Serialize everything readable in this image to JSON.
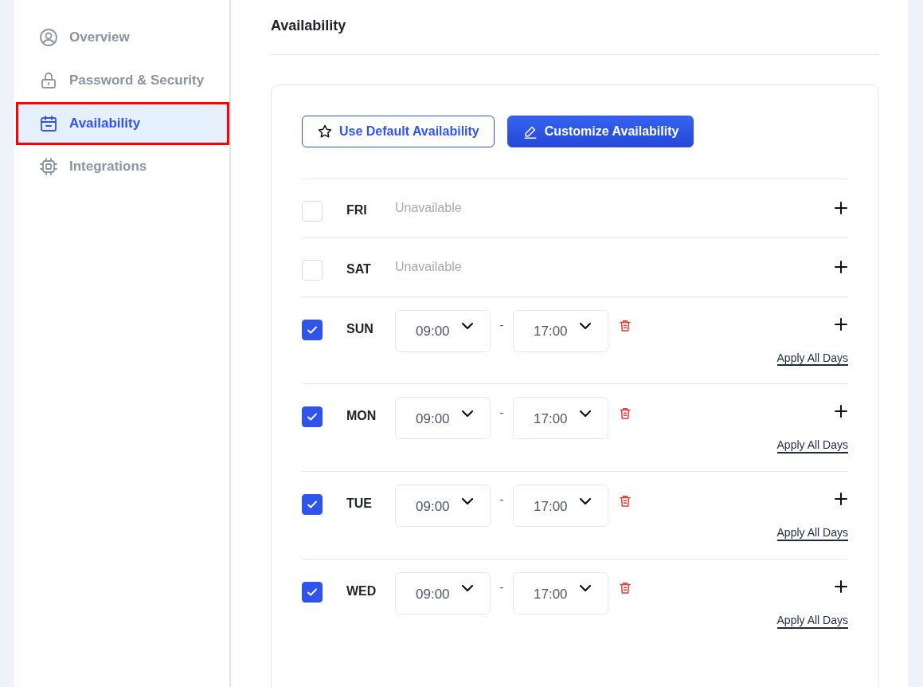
{
  "sidebar": {
    "items": [
      {
        "label": "Overview",
        "selected": false,
        "highlighted": false
      },
      {
        "label": "Password & Security",
        "selected": false,
        "highlighted": false
      },
      {
        "label": "Availability",
        "selected": true,
        "highlighted": true
      },
      {
        "label": "Integrations",
        "selected": false,
        "highlighted": false
      }
    ]
  },
  "main": {
    "title": "Availability"
  },
  "mode_buttons": [
    {
      "label": "Use Default Availability",
      "selected": false
    },
    {
      "label": "Customize Availability",
      "selected": true
    }
  ],
  "days": [
    {
      "day": "FRI",
      "checked": false,
      "status": "Unavailable"
    },
    {
      "day": "SAT",
      "checked": false,
      "status": "Unavailable"
    },
    {
      "day": "SUN",
      "checked": true,
      "slots": [
        {
          "start": "09:00",
          "separator": "-",
          "end": "17:00"
        }
      ],
      "apply_label": "Apply All Days"
    },
    {
      "day": "MON",
      "checked": true,
      "slots": [
        {
          "start": "09:00",
          "separator": "-",
          "end": "17:00"
        }
      ],
      "apply_label": "Apply All Days"
    },
    {
      "day": "TUE",
      "checked": true,
      "slots": [
        {
          "start": "09:00",
          "separator": "-",
          "end": "17:00"
        }
      ],
      "apply_label": "Apply All Days"
    },
    {
      "day": "WED",
      "checked": true,
      "slots": [
        {
          "start": "09:00",
          "separator": "-",
          "end": "17:00"
        }
      ],
      "apply_label": "Apply All Days"
    }
  ]
}
